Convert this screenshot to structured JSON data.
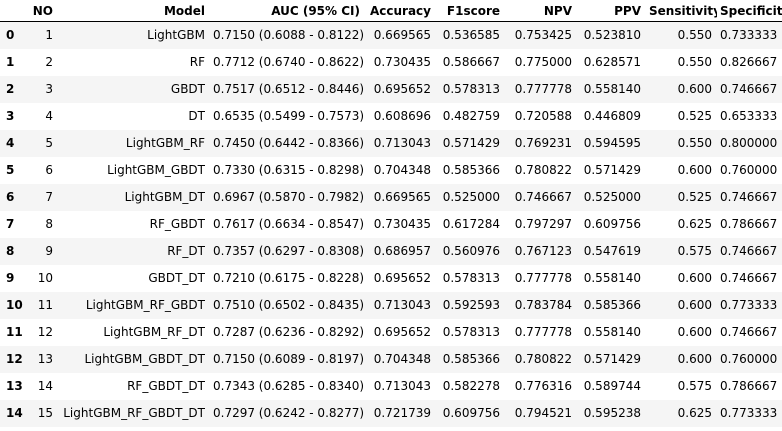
{
  "table": {
    "columns": [
      "",
      "NO",
      "Model",
      "AUC (95% CI)",
      "Accuracy",
      "F1score",
      "NPV",
      "PPV",
      "Sensitivity",
      "Specificity"
    ],
    "rows": [
      {
        "index": "0",
        "cells": [
          "1",
          "LightGBM",
          "0.7150 (0.6088 - 0.8122)",
          "0.669565",
          "0.536585",
          "0.753425",
          "0.523810",
          "0.550",
          "0.733333"
        ]
      },
      {
        "index": "1",
        "cells": [
          "2",
          "RF",
          "0.7712 (0.6740 - 0.8622)",
          "0.730435",
          "0.586667",
          "0.775000",
          "0.628571",
          "0.550",
          "0.826667"
        ]
      },
      {
        "index": "2",
        "cells": [
          "3",
          "GBDT",
          "0.7517 (0.6512 - 0.8446)",
          "0.695652",
          "0.578313",
          "0.777778",
          "0.558140",
          "0.600",
          "0.746667"
        ]
      },
      {
        "index": "3",
        "cells": [
          "4",
          "DT",
          "0.6535 (0.5499 - 0.7573)",
          "0.608696",
          "0.482759",
          "0.720588",
          "0.446809",
          "0.525",
          "0.653333"
        ]
      },
      {
        "index": "4",
        "cells": [
          "5",
          "LightGBM_RF",
          "0.7450 (0.6442 - 0.8366)",
          "0.713043",
          "0.571429",
          "0.769231",
          "0.594595",
          "0.550",
          "0.800000"
        ]
      },
      {
        "index": "5",
        "cells": [
          "6",
          "LightGBM_GBDT",
          "0.7330 (0.6315 - 0.8298)",
          "0.704348",
          "0.585366",
          "0.780822",
          "0.571429",
          "0.600",
          "0.760000"
        ]
      },
      {
        "index": "6",
        "cells": [
          "7",
          "LightGBM_DT",
          "0.6967 (0.5870 - 0.7982)",
          "0.669565",
          "0.525000",
          "0.746667",
          "0.525000",
          "0.525",
          "0.746667"
        ]
      },
      {
        "index": "7",
        "cells": [
          "8",
          "RF_GBDT",
          "0.7617 (0.6634 - 0.8547)",
          "0.730435",
          "0.617284",
          "0.797297",
          "0.609756",
          "0.625",
          "0.786667"
        ]
      },
      {
        "index": "8",
        "cells": [
          "9",
          "RF_DT",
          "0.7357 (0.6297 - 0.8308)",
          "0.686957",
          "0.560976",
          "0.767123",
          "0.547619",
          "0.575",
          "0.746667"
        ]
      },
      {
        "index": "9",
        "cells": [
          "10",
          "GBDT_DT",
          "0.7210 (0.6175 - 0.8228)",
          "0.695652",
          "0.578313",
          "0.777778",
          "0.558140",
          "0.600",
          "0.746667"
        ]
      },
      {
        "index": "10",
        "cells": [
          "11",
          "LightGBM_RF_GBDT",
          "0.7510 (0.6502 - 0.8435)",
          "0.713043",
          "0.592593",
          "0.783784",
          "0.585366",
          "0.600",
          "0.773333"
        ]
      },
      {
        "index": "11",
        "cells": [
          "12",
          "LightGBM_RF_DT",
          "0.7287 (0.6236 - 0.8292)",
          "0.695652",
          "0.578313",
          "0.777778",
          "0.558140",
          "0.600",
          "0.746667"
        ]
      },
      {
        "index": "12",
        "cells": [
          "13",
          "LightGBM_GBDT_DT",
          "0.7150 (0.6089 - 0.8197)",
          "0.704348",
          "0.585366",
          "0.780822",
          "0.571429",
          "0.600",
          "0.760000"
        ]
      },
      {
        "index": "13",
        "cells": [
          "14",
          "RF_GBDT_DT",
          "0.7343 (0.6285 - 0.8340)",
          "0.713043",
          "0.582278",
          "0.776316",
          "0.589744",
          "0.575",
          "0.786667"
        ]
      },
      {
        "index": "14",
        "cells": [
          "15",
          "LightGBM_RF_GBDT_DT",
          "0.7297 (0.6242 - 0.8277)",
          "0.721739",
          "0.609756",
          "0.794521",
          "0.595238",
          "0.625",
          "0.773333"
        ]
      }
    ]
  }
}
